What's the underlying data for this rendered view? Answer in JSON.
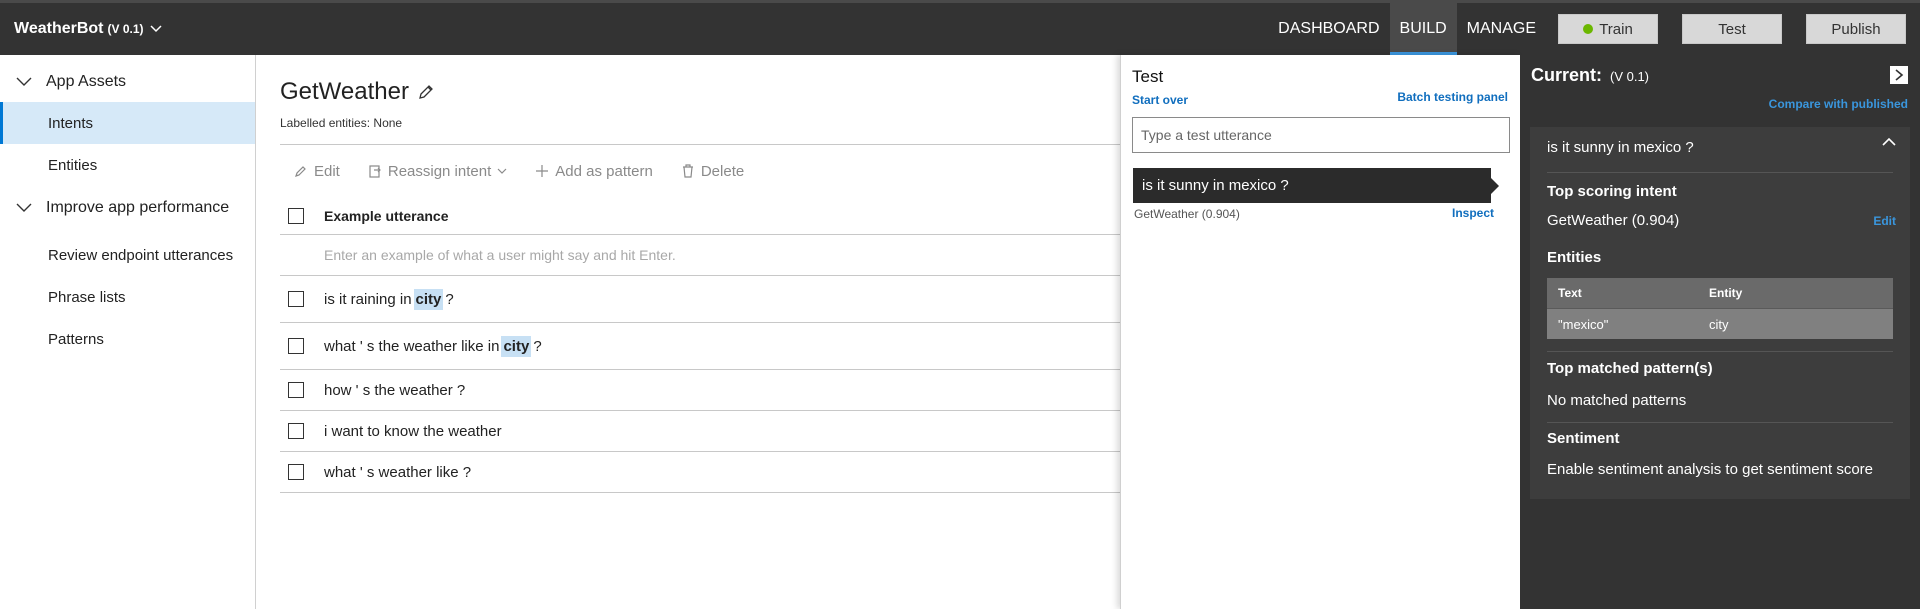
{
  "app": {
    "name": "WeatherBot",
    "version": "(V 0.1)"
  },
  "nav": {
    "dashboard": "DASHBOARD",
    "build": "BUILD",
    "manage": "MANAGE",
    "train": "Train",
    "test": "Test",
    "publish": "Publish"
  },
  "sidebar": {
    "group1": "App Assets",
    "intents": "Intents",
    "entities": "Entities",
    "group2": "Improve app performance",
    "review": "Review endpoint utterances",
    "phrase": "Phrase lists",
    "patterns": "Patterns"
  },
  "main": {
    "title": "GetWeather",
    "labelled": "Labelled entities: None",
    "toolbar": {
      "edit": "Edit",
      "reassign": "Reassign intent",
      "pattern": "Add as pattern",
      "delete": "Delete"
    },
    "col_header": "Example utterance",
    "new_placeholder": "Enter an example of what a user might say and hit Enter.",
    "rows": [
      {
        "before": "is it raining in",
        "entity": "city",
        "after": "?"
      },
      {
        "before": "what ' s the weather like in",
        "entity": "city",
        "after": "?"
      },
      {
        "text": "how ' s the weather ?"
      },
      {
        "text": "i want to know the weather"
      },
      {
        "text": "what ' s weather like ?"
      }
    ]
  },
  "test_panel": {
    "title": "Test",
    "start_over": "Start over",
    "batch": "Batch testing panel",
    "placeholder": "Type a test utterance",
    "utterance": "is it sunny in mexico ?",
    "result": "GetWeather (0.904)",
    "inspect": "Inspect"
  },
  "inspect_panel": {
    "heading": "Current:",
    "version": "(V 0.1)",
    "compare": "Compare with published",
    "utterance": "is it sunny in mexico ?",
    "top_intent_h": "Top scoring intent",
    "top_intent": "GetWeather (0.904)",
    "edit": "Edit",
    "entities_h": "Entities",
    "ent_col_text": "Text",
    "ent_col_entity": "Entity",
    "ent_text": "\"mexico\"",
    "ent_entity": "city",
    "patterns_h": "Top matched pattern(s)",
    "patterns": "No matched patterns",
    "sentiment_h": "Sentiment",
    "sentiment": "Enable sentiment analysis to get sentiment score"
  },
  "colors": {
    "topbar": "#333333",
    "accent": "#0078d4",
    "train_dot": "#6bb700",
    "inspect_bg": "#333333"
  }
}
